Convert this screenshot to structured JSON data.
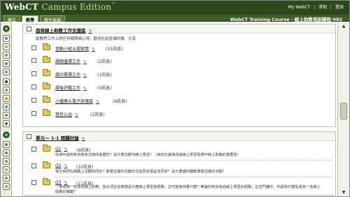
{
  "app": {
    "brand": "WebCT",
    "edition": "Campus Edition",
    "edition_mark": "™"
  },
  "top_links": [
    "My WebCT",
    "求助",
    "登出"
  ],
  "tabs": [
    {
      "label": "建立",
      "active": false
    },
    {
      "label": "教學",
      "active": true
    },
    {
      "label": "學生檢視",
      "active": false
    }
  ],
  "course_title": "WebCT Training Course - 線上助教培訓課程-982",
  "section1": {
    "title": "酉原線上助教工作支援區",
    "pct_icon": "%",
    "description": "助教們工作上的任何疑問或心得，歡迎在此區域討論、分享",
    "rows": [
      {
        "label": "音動小組＆甜家窩",
        "count": "(15訊息)"
      },
      {
        "label": "課綱邊擇工作",
        "count": "(2訊息)"
      },
      {
        "label": "課中需擇工作",
        "count": "(1訊息)"
      },
      {
        "label": "課後評鑑工作",
        "count": "(0訊息)"
      },
      {
        "label": "小檔冊＆電子部落區",
        "count": "(6訊息)"
      },
      {
        "label": "發信公函",
        "count": "(1訊息)"
      }
    ]
  },
  "section2": {
    "title": "單元一  1-1 開闢討論",
    "pct_icon": "%",
    "rows": [
      {
        "label": "Q1",
        "count": "(9訊息)",
        "desc": "情境中提到有何會有這樣的進展性？是什麼活動可線上學習？（目的在讓導改過線上學習情境中線上助教的重要性）"
      },
      {
        "label": "Q2",
        "count": "(10訊息)",
        "desc": "學生我們在網路上活動的同步？那麼這樣的活動形式是同步還是非同步？是什麼讓你聽教學與這樣的活動？"
      },
      {
        "label": "Q3",
        "count": "(11訊息)",
        "desc": "「要成西一些學校線上助教，其必須在此環境是什麼線上學習曾經驗，這可能會持著什麼？無論你有沒有過線上學習的經驗，在這門課中，你認為什麼是成為一名線上助教的關鍵？"
      }
    ]
  },
  "icons": {
    "checkbox": "checkbox-icon",
    "folder": "folder-icon",
    "percent": "percent-icon"
  },
  "colors": {
    "header_bg": "#2b4a1a",
    "tab_active": "#eef3e6",
    "folder": "#e9c84a"
  }
}
